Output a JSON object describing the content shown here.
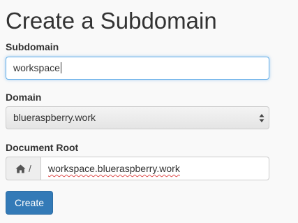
{
  "page": {
    "title": "Create a Subdomain"
  },
  "form": {
    "subdomain": {
      "label": "Subdomain",
      "value": "workspace"
    },
    "domain": {
      "label": "Domain",
      "selected": "blueraspberry.work"
    },
    "document_root": {
      "label": "Document Root",
      "prefix_icon": "home-icon",
      "prefix_text": "/",
      "value": "workspace.blueraspberry.work"
    },
    "submit_label": "Create"
  },
  "colors": {
    "primary_button": "#337ab7",
    "focus_border": "#66afe9",
    "spellcheck_underline": "#e05050"
  }
}
